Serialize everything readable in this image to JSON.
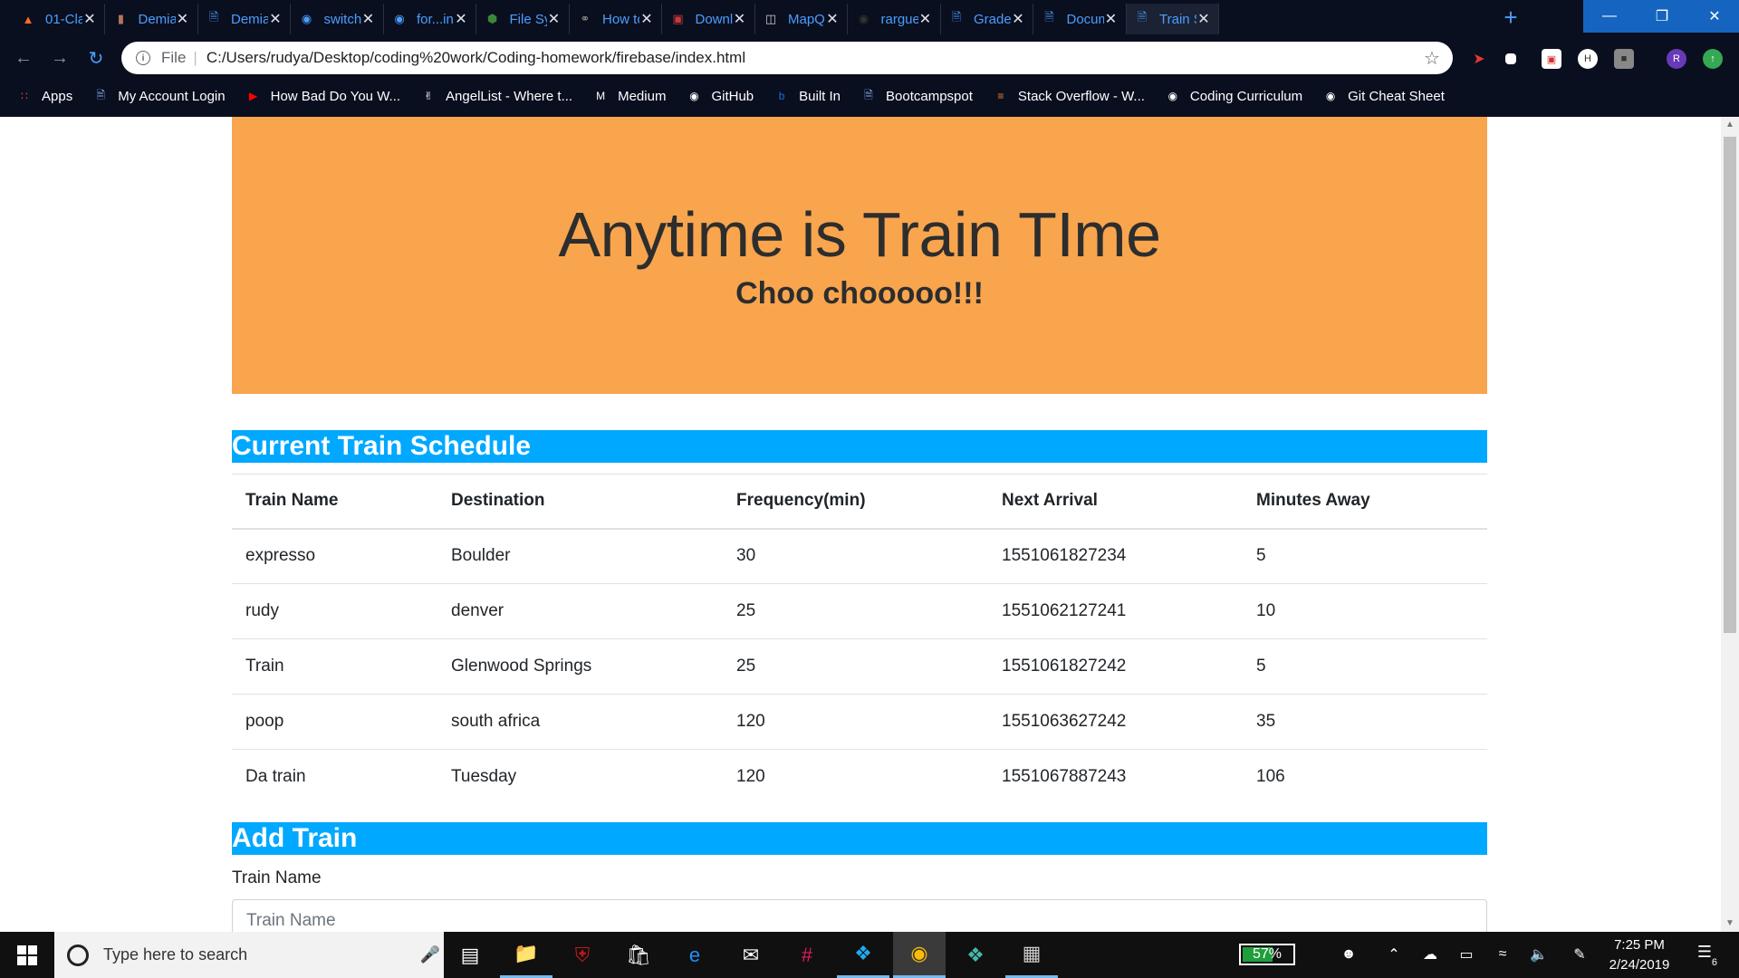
{
  "browser": {
    "tabs": [
      {
        "label": "01-Cla",
        "icon": "gitlab-icon",
        "color": "#fc6d26"
      },
      {
        "label": "Demian",
        "icon": "page-icon",
        "color": "#b8735a"
      },
      {
        "label": "Demian",
        "icon": "document-icon",
        "color": "#4a9eff"
      },
      {
        "label": "switch",
        "icon": "github-icon",
        "color": "#4a9eff"
      },
      {
        "label": "for...in",
        "icon": "github-icon",
        "color": "#4a9eff"
      },
      {
        "label": "File Sy",
        "icon": "node-icon",
        "color": "#3c873a"
      },
      {
        "label": "How to",
        "icon": "link-icon",
        "color": "#888888"
      },
      {
        "label": "Downl",
        "icon": "npm-icon",
        "color": "#cb3837"
      },
      {
        "label": "MapQ",
        "icon": "map-icon",
        "color": "#cccccc"
      },
      {
        "label": "rargue",
        "icon": "github-icon",
        "color": "#333333"
      },
      {
        "label": "Grade",
        "icon": "document-icon",
        "color": "#4a9eff"
      },
      {
        "label": "Docum",
        "icon": "document-icon",
        "color": "#4a9eff"
      },
      {
        "label": "Train S",
        "icon": "document-icon",
        "color": "#4a9eff"
      }
    ],
    "new_tab": "+",
    "address": {
      "scheme": "File",
      "url": "C:/Users/rudya/Desktop/coding%20work/Coding-homework/firebase/index.html"
    },
    "bookmarks": [
      {
        "label": "Apps",
        "icon": "apps-grid-icon"
      },
      {
        "label": "My Account Login",
        "icon": "document-icon"
      },
      {
        "label": "How Bad Do You W...",
        "icon": "youtube-icon"
      },
      {
        "label": "AngelList - Where t...",
        "icon": "angellist-icon"
      },
      {
        "label": "Medium",
        "icon": "medium-icon"
      },
      {
        "label": "GitHub",
        "icon": "github-icon"
      },
      {
        "label": "Built In",
        "icon": "builtin-icon"
      },
      {
        "label": "Bootcampspot",
        "icon": "document-icon"
      },
      {
        "label": "Stack Overflow - W...",
        "icon": "stackoverflow-icon"
      },
      {
        "label": "Coding Curriculum",
        "icon": "github-icon"
      },
      {
        "label": "Git Cheat Sheet",
        "icon": "github-icon"
      }
    ]
  },
  "page": {
    "title": "Anytime is Train TIme",
    "subtitle": "Choo chooooo!!!",
    "schedule_heading": "Current Train Schedule",
    "table": {
      "headers": [
        "Train Name",
        "Destination",
        "Frequency(min)",
        "Next Arrival",
        "Minutes Away"
      ],
      "rows": [
        [
          "expresso",
          "Boulder",
          "30",
          "1551061827234",
          "5"
        ],
        [
          "rudy",
          "denver",
          "25",
          "1551062127241",
          "10"
        ],
        [
          "Train",
          "Glenwood Springs",
          "25",
          "1551061827242",
          "5"
        ],
        [
          "poop",
          "south africa",
          "120",
          "1551063627242",
          "35"
        ],
        [
          "Da train",
          "Tuesday",
          "120",
          "1551067887243",
          "106"
        ]
      ]
    },
    "add_heading": "Add Train",
    "form": {
      "train_name_label": "Train Name",
      "train_name_placeholder": "Train Name",
      "train_name_value": ""
    },
    "colors": {
      "jumbotron": "#f8a54e",
      "section_bar": "#00a8ff"
    }
  },
  "taskbar": {
    "search_placeholder": "Type here to search",
    "apps": [
      "task-view-icon",
      "file-explorer-icon",
      "mcafee-icon",
      "store-icon",
      "edge-icon",
      "mail-icon",
      "slack-icon",
      "vscode-icon",
      "chrome-icon",
      "gitkraken-icon",
      "terminal-icon"
    ],
    "battery": "57%",
    "battery_level": 0.57,
    "time": "7:25 PM",
    "date": "2/24/2019",
    "notifications": "6"
  }
}
